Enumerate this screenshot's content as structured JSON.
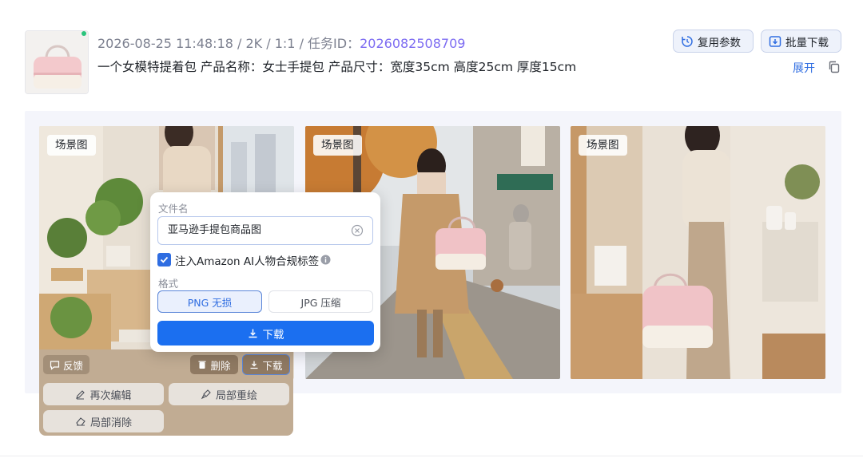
{
  "header": {
    "date": "2026-08-25 11:48:18",
    "resolution": "2K",
    "ratio": "1:1",
    "task_id_label": "任务ID：",
    "task_id": "2026082508709",
    "separator": " / ",
    "prompt": "一个女模特提着包 产品名称：女士手提包 产品尺寸：宽度35cm 高度25cm 厚度15cm",
    "reuse_label": "复用参数",
    "batch_download_label": "批量下载",
    "expand_label": "展开"
  },
  "gallery": {
    "cards": [
      {
        "tag": "场景图"
      },
      {
        "tag": "场景图"
      },
      {
        "tag": "场景图"
      }
    ]
  },
  "card_actions": {
    "feedback_label": "反馈",
    "delete_label": "删除",
    "download_label": "下载",
    "reedit_label": "再次编辑",
    "repaint_label": "局部重绘",
    "erase_label": "局部消除"
  },
  "download_popover": {
    "filename_label": "文件名",
    "filename_value": "亚马逊手提包商品图",
    "inject_label": "注入Amazon AI人物合规标签",
    "inject_checked": true,
    "format_label": "格式",
    "formats": [
      {
        "label": "PNG 无损",
        "selected": true
      },
      {
        "label": "JPG 压缩",
        "selected": false
      }
    ],
    "download_label": "下载"
  },
  "colors": {
    "accent": "#2f6de1",
    "task_id": "#7d6cf2",
    "primary_button": "#1b6ff0",
    "hover_panel": "#c1ac93"
  }
}
